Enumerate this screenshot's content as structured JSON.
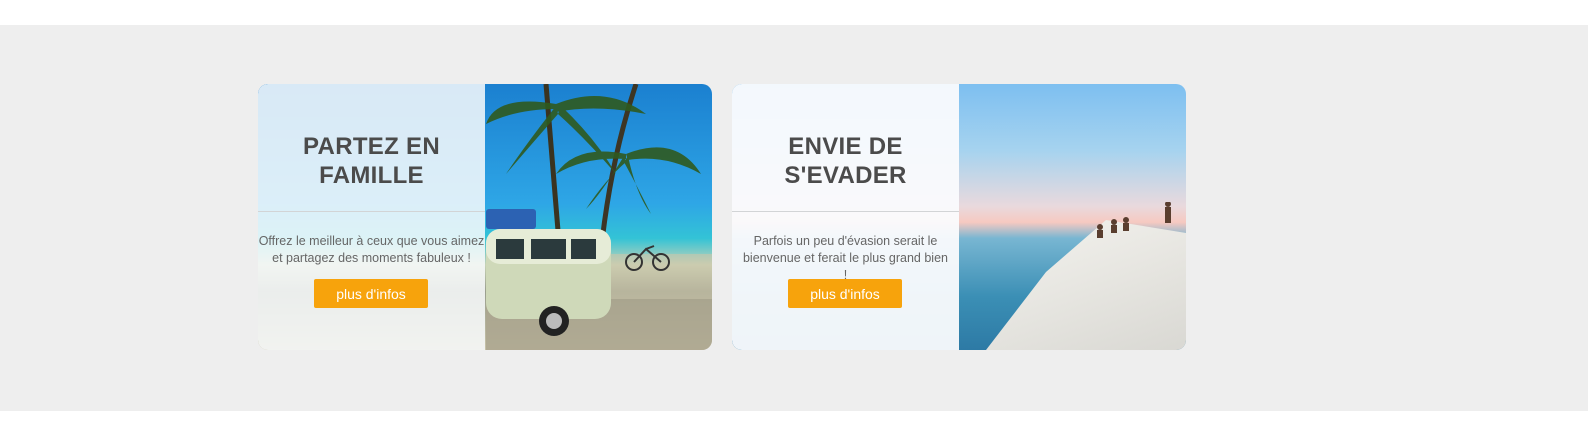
{
  "cards": [
    {
      "title_line1": "PARTEZ EN",
      "title_line2": "FAMILLE",
      "description": "Offrez le meilleur à ceux que vous aimez et partagez des moments fabuleux !",
      "button_label": "plus d'infos",
      "image_subject": "beach-van-palms-image"
    },
    {
      "title_line1": "ENVIE DE",
      "title_line2": "S'EVADER",
      "description": "Parfois un peu d'évasion serait le bienvenue et ferait le plus grand bien !",
      "button_label": "plus d'infos",
      "image_subject": "sea-cliff-image"
    }
  ],
  "colors": {
    "background": "#eeeeee",
    "button": "#f7a30c",
    "title": "#4b4b4b"
  }
}
